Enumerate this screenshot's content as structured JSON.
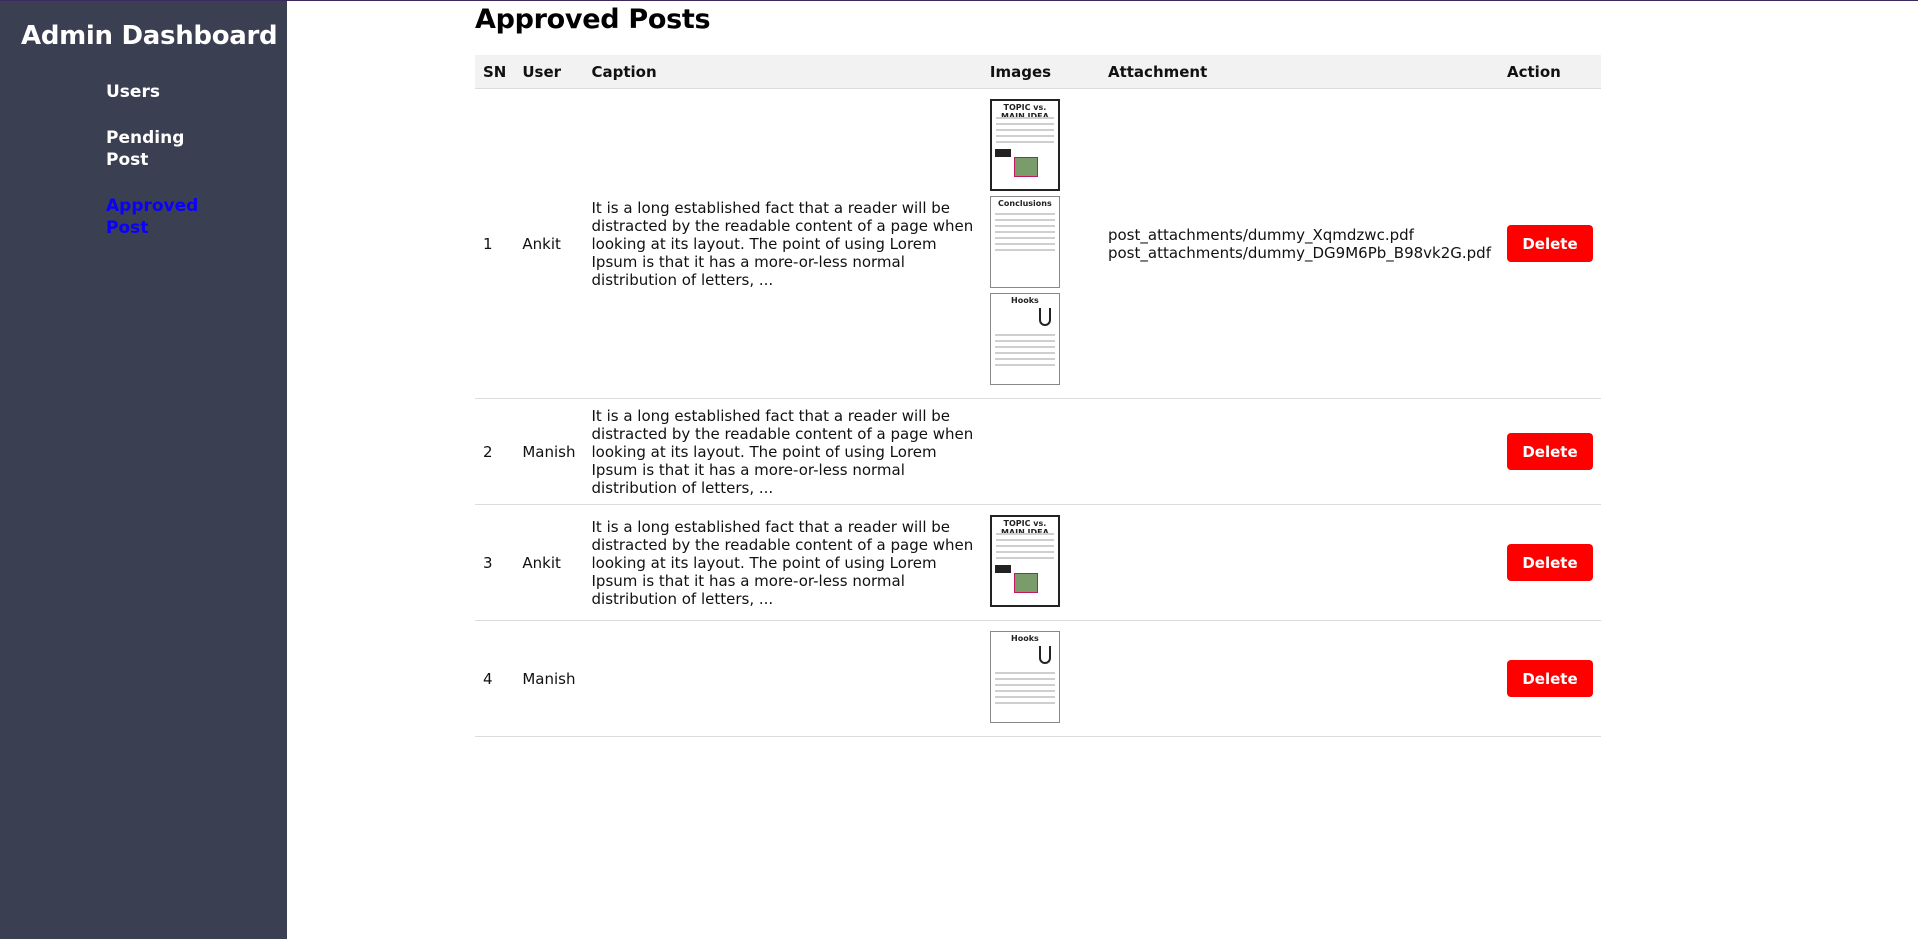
{
  "sidebar": {
    "title": "Admin Dashboard",
    "items": [
      {
        "label": "Users",
        "active": false
      },
      {
        "label": "Pending Post",
        "active": false
      },
      {
        "label": "Approved Post",
        "active": true
      }
    ]
  },
  "page": {
    "title": "Approved Posts"
  },
  "table": {
    "headers": [
      "SN",
      "User",
      "Caption",
      "Images",
      "Attachment",
      "Action"
    ],
    "rows": [
      {
        "sn": "1",
        "user": "Ankit",
        "caption": "It is a long established fact that a reader will be distracted by the readable content of a page when looking at its layout. The point of using Lorem Ipsum is that it has a more-or-less normal distribution of letters, ...",
        "images": [
          "TOPIC vs. MAIN IDEA",
          "Conclusions",
          "Hooks"
        ],
        "attachments": [
          "post_attachments/dummy_Xqmdzwc.pdf",
          "post_attachments/dummy_DG9M6Pb_B98vk2G.pdf"
        ],
        "action": "Delete"
      },
      {
        "sn": "2",
        "user": "Manish",
        "caption": "It is a long established fact that a reader will be distracted by the readable content of a page when looking at its layout. The point of using Lorem Ipsum is that it has a more-or-less normal distribution of letters, ...",
        "images": [],
        "attachments": [],
        "action": "Delete"
      },
      {
        "sn": "3",
        "user": "Ankit",
        "caption": "It is a long established fact that a reader will be distracted by the readable content of a page when looking at its layout. The point of using Lorem Ipsum is that it has a more-or-less normal distribution of letters, ...",
        "images": [
          "TOPIC vs. MAIN IDEA"
        ],
        "attachments": [],
        "action": "Delete"
      },
      {
        "sn": "4",
        "user": "Manish",
        "caption": "",
        "images": [
          "Hooks"
        ],
        "attachments": [],
        "action": "Delete"
      }
    ]
  },
  "colors": {
    "sidebar_bg": "#3a3f51",
    "active_link": "#0a00ff",
    "delete_button": "#ff0000",
    "header_bg": "#f2f2f2"
  }
}
